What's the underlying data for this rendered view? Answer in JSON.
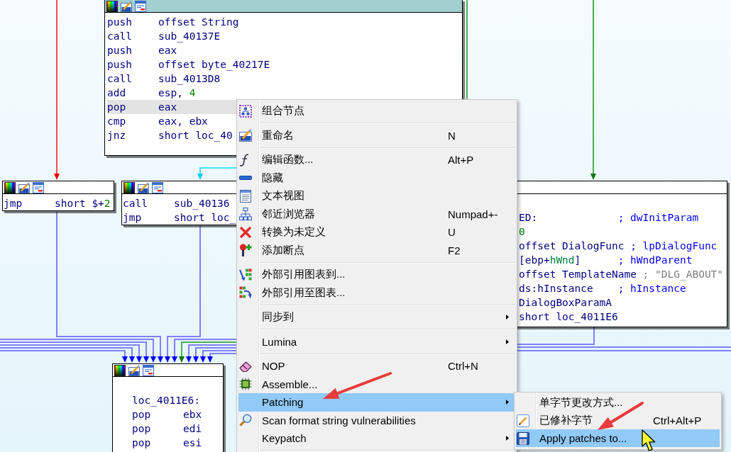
{
  "nodes": [
    {
      "selected": true,
      "lines": [
        {
          "kind": "code",
          "mnemonic": "push",
          "operand": "offset String",
          "highlighted": false
        },
        {
          "kind": "code",
          "mnemonic": "call",
          "operand": "sub_40137E",
          "highlighted": false
        },
        {
          "kind": "code",
          "mnemonic": "push",
          "operand": "eax",
          "highlighted": false
        },
        {
          "kind": "code",
          "mnemonic": "push",
          "operand": "offset byte_40217E",
          "highlighted": false
        },
        {
          "kind": "code",
          "mnemonic": "call",
          "operand": "sub_4013D8",
          "highlighted": false
        },
        {
          "kind": "code",
          "mnemonic": "add",
          "operand": [
            {
              "text": "esp, ",
              "kind": "plain"
            },
            {
              "text": "4",
              "kind": "number"
            }
          ],
          "highlighted": false
        },
        {
          "kind": "code",
          "mnemonic": "pop",
          "operand": "eax",
          "highlighted": true
        },
        {
          "kind": "code",
          "mnemonic": "cmp",
          "operand": "eax, ebx",
          "highlighted": false
        },
        {
          "kind": "code",
          "mnemonic": "jnz",
          "operand": "short loc_40",
          "highlighted": false
        }
      ]
    },
    {
      "selected": false,
      "lines": [
        {
          "kind": "code",
          "mnemonic": "jmp",
          "operand": [
            {
              "text": "short $+",
              "kind": "plain"
            },
            {
              "text": "2",
              "kind": "number"
            }
          ],
          "highlighted": false
        }
      ]
    },
    {
      "selected": false,
      "lines": [
        {
          "kind": "code",
          "mnemonic": "call",
          "operand": "sub_40136",
          "highlighted": false
        },
        {
          "kind": "code",
          "mnemonic": "jmp",
          "operand": "short loc_",
          "highlighted": false
        }
      ]
    },
    {
      "selected": false,
      "lines": [
        {
          "kind": "label",
          "text": "ED:",
          "comment": {
            "text": "; dwInitParam",
            "kind": "name"
          },
          "highlighted": false
        },
        {
          "kind": "code",
          "operand": [
            {
              "text": "0",
              "kind": "number"
            }
          ],
          "highlighted": false
        },
        {
          "kind": "code",
          "operand": "offset DialogFunc",
          "comment": {
            "text": "; lpDialogFunc",
            "kind": "name"
          },
          "highlighted": false
        },
        {
          "kind": "code",
          "operand": [
            {
              "text": "[ebp+",
              "kind": "plain"
            },
            {
              "text": "hWnd",
              "kind": "variable"
            },
            {
              "text": "]",
              "kind": "plain"
            }
          ],
          "comment": {
            "text": "; hWndParent",
            "kind": "name"
          },
          "highlighted": false
        },
        {
          "kind": "code",
          "operand": "offset TemplateName",
          "comment": {
            "text": "; \"DLG_ABOUT\"",
            "kind": "string"
          },
          "highlighted": false
        },
        {
          "kind": "code",
          "operand": "ds:hInstance",
          "comment": {
            "text": "; hInstance",
            "kind": "name"
          },
          "highlighted": false
        },
        {
          "kind": "code",
          "operand": "DialogBoxParamA",
          "highlighted": false
        },
        {
          "kind": "code",
          "operand": "short loc_4011E6",
          "highlighted": false
        }
      ]
    },
    {
      "selected": false,
      "lines": [
        {
          "kind": "label",
          "text": "loc_4011E6:",
          "highlighted": false
        },
        {
          "kind": "code",
          "mnemonic": "pop",
          "operand": "ebx",
          "highlighted": false
        },
        {
          "kind": "code",
          "mnemonic": "pop",
          "operand": "edi",
          "highlighted": false
        },
        {
          "kind": "code",
          "mnemonic": "pop",
          "operand": "esi",
          "highlighted": false
        }
      ]
    }
  ],
  "context_menu": {
    "items": [
      {
        "kind": "item",
        "label": "组合节点",
        "has_submenu": false,
        "selected": false
      },
      {
        "kind": "separator"
      },
      {
        "kind": "item",
        "label": "重命名",
        "shortcut": "N",
        "has_submenu": false,
        "selected": false
      },
      {
        "kind": "separator"
      },
      {
        "kind": "item",
        "label": "编辑函数...",
        "shortcut": "Alt+P",
        "has_submenu": false,
        "selected": false
      },
      {
        "kind": "item",
        "label": "隐藏",
        "has_submenu": false,
        "selected": false
      },
      {
        "kind": "item",
        "label": "文本视图",
        "has_submenu": false,
        "selected": false
      },
      {
        "kind": "item",
        "label": "邻近浏览器",
        "shortcut": "Numpad+-",
        "has_submenu": false,
        "selected": false
      },
      {
        "kind": "item",
        "label": "转换为未定义",
        "shortcut": "U",
        "has_submenu": false,
        "selected": false
      },
      {
        "kind": "item",
        "label": "添加断点",
        "shortcut": "F2",
        "has_submenu": false,
        "selected": false
      },
      {
        "kind": "separator"
      },
      {
        "kind": "item",
        "label": "外部引用图表到...",
        "has_submenu": false,
        "selected": false
      },
      {
        "kind": "item",
        "label": "外部引用至图表...",
        "has_submenu": false,
        "selected": false
      },
      {
        "kind": "separator"
      },
      {
        "kind": "item",
        "label": "同步到",
        "has_submenu": true,
        "selected": false
      },
      {
        "kind": "separator"
      },
      {
        "kind": "item",
        "label": "Lumina",
        "has_submenu": true,
        "selected": false
      },
      {
        "kind": "separator"
      },
      {
        "kind": "item",
        "label": "NOP",
        "shortcut": "Ctrl+N",
        "has_submenu": false,
        "selected": false
      },
      {
        "kind": "item",
        "label": "Assemble...",
        "has_submenu": false,
        "selected": false
      },
      {
        "kind": "item",
        "label": "Patching",
        "has_submenu": true,
        "selected": true
      },
      {
        "kind": "item",
        "label": "Scan format string vulnerabilities",
        "has_submenu": false,
        "selected": false
      },
      {
        "kind": "item",
        "label": "Keypatch",
        "has_submenu": true,
        "selected": false
      },
      {
        "kind": "separator"
      }
    ]
  },
  "patching_submenu": {
    "items": [
      {
        "kind": "item",
        "label": "单字节更改方式...",
        "selected": false
      },
      {
        "kind": "item",
        "label": "已修补字节",
        "shortcut": "Ctrl+Alt+P",
        "selected": false
      },
      {
        "kind": "item",
        "label": "Apply patches to...",
        "selected": true
      }
    ]
  }
}
